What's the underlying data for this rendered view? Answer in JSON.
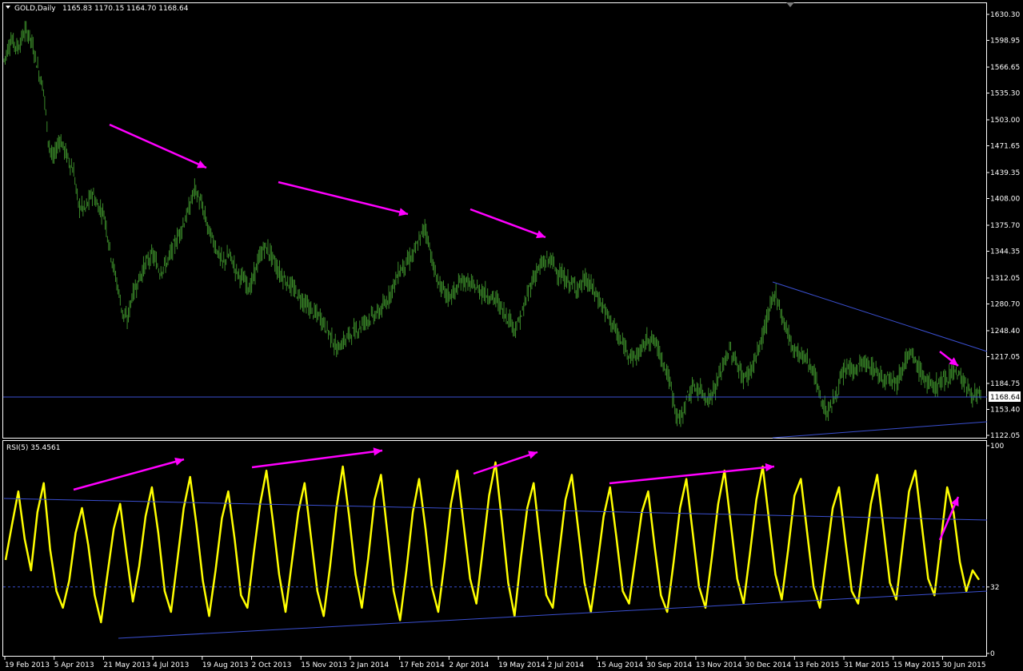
{
  "header": {
    "symbol": "GOLD,Daily",
    "ohlc": "1165.83 1170.15 1164.70 1168.64",
    "rsi_label": "RSI(5) 35.4561"
  },
  "colors": {
    "background": "#000000",
    "border": "#ffffff",
    "candles": "#3b8a2a",
    "rsi": "#ffff00",
    "trendline": "#3a4fcf",
    "arrow": "#ff00ff",
    "price_tag_bg": "#ffffff",
    "price_tag_text": "#000000"
  },
  "price_axis": [
    "1630.30",
    "1598.95",
    "1566.65",
    "1535.30",
    "1503.00",
    "1471.65",
    "1439.35",
    "1408.00",
    "1375.70",
    "1344.35",
    "1312.05",
    "1280.70",
    "1248.40",
    "1217.05",
    "1184.75",
    "1153.40",
    "1122.05"
  ],
  "current_price_tag": "1168.64",
  "rsi_axis": [
    "100",
    "32",
    "0"
  ],
  "date_axis": [
    "19 Feb 2013",
    "5 Apr 2013",
    "21 May 2013",
    "4 Jul 2013",
    "19 Aug 2013",
    "2 Oct 2013",
    "15 Nov 2013",
    "2 Jan 2014",
    "17 Feb 2014",
    "2 Apr 2014",
    "19 May 2014",
    "2 Jul 2014",
    "15 Aug 2014",
    "30 Sep 2014",
    "13 Nov 2014",
    "30 Dec 2014",
    "13 Feb 2015",
    "31 Mar 2015",
    "15 May 2015",
    "30 Jun 2015"
  ],
  "chart_data": [
    {
      "type": "line",
      "title": "GOLD,Daily",
      "x_range": [
        "19 Feb 2013",
        "30 Jun 2015"
      ],
      "ylim": [
        1122.05,
        1630.3
      ],
      "series": [
        {
          "name": "GOLD,Daily",
          "points": [
            [
              0,
              1575
            ],
            [
              6,
              1600
            ],
            [
              12,
              1590
            ],
            [
              18,
              1610
            ],
            [
              22,
              1605
            ],
            [
              26,
              1585
            ],
            [
              30,
              1560
            ],
            [
              34,
              1540
            ],
            [
              38,
              1480
            ],
            [
              42,
              1455
            ],
            [
              48,
              1480
            ],
            [
              54,
              1460
            ],
            [
              60,
              1440
            ],
            [
              64,
              1400
            ],
            [
              70,
              1395
            ],
            [
              76,
              1415
            ],
            [
              80,
              1400
            ],
            [
              86,
              1390
            ],
            [
              92,
              1340
            ],
            [
              98,
              1300
            ],
            [
              102,
              1270
            ],
            [
              106,
              1260
            ],
            [
              110,
              1290
            ],
            [
              116,
              1310
            ],
            [
              122,
              1330
            ],
            [
              128,
              1340
            ],
            [
              134,
              1320
            ],
            [
              140,
              1330
            ],
            [
              146,
              1350
            ],
            [
              152,
              1370
            ],
            [
              158,
              1390
            ],
            [
              164,
              1420
            ],
            [
              170,
              1400
            ],
            [
              176,
              1370
            ],
            [
              182,
              1350
            ],
            [
              188,
              1330
            ],
            [
              194,
              1340
            ],
            [
              200,
              1320
            ],
            [
              206,
              1310
            ],
            [
              212,
              1300
            ],
            [
              218,
              1330
            ],
            [
              224,
              1350
            ],
            [
              230,
              1340
            ],
            [
              236,
              1320
            ],
            [
              242,
              1310
            ],
            [
              248,
              1300
            ],
            [
              254,
              1290
            ],
            [
              260,
              1280
            ],
            [
              266,
              1270
            ],
            [
              272,
              1265
            ],
            [
              278,
              1250
            ],
            [
              282,
              1240
            ],
            [
              286,
              1225
            ],
            [
              292,
              1235
            ],
            [
              298,
              1245
            ],
            [
              304,
              1250
            ],
            [
              310,
              1260
            ],
            [
              316,
              1265
            ],
            [
              322,
              1270
            ],
            [
              328,
              1280
            ],
            [
              334,
              1300
            ],
            [
              340,
              1320
            ],
            [
              346,
              1330
            ],
            [
              352,
              1340
            ],
            [
              358,
              1360
            ],
            [
              362,
              1375
            ],
            [
              366,
              1350
            ],
            [
              370,
              1320
            ],
            [
              376,
              1300
            ],
            [
              382,
              1290
            ],
            [
              388,
              1295
            ],
            [
              394,
              1310
            ],
            [
              400,
              1305
            ],
            [
              406,
              1300
            ],
            [
              412,
              1295
            ],
            [
              418,
              1290
            ],
            [
              424,
              1285
            ],
            [
              430,
              1270
            ],
            [
              436,
              1260
            ],
            [
              440,
              1250
            ],
            [
              446,
              1270
            ],
            [
              452,
              1300
            ],
            [
              458,
              1320
            ],
            [
              464,
              1330
            ],
            [
              470,
              1335
            ],
            [
              476,
              1320
            ],
            [
              482,
              1310
            ],
            [
              488,
              1305
            ],
            [
              494,
              1300
            ],
            [
              500,
              1310
            ],
            [
              506,
              1300
            ],
            [
              512,
              1285
            ],
            [
              518,
              1270
            ],
            [
              524,
              1255
            ],
            [
              530,
              1235
            ],
            [
              536,
              1225
            ],
            [
              542,
              1215
            ],
            [
              548,
              1225
            ],
            [
              554,
              1240
            ],
            [
              560,
              1235
            ],
            [
              566,
              1215
            ],
            [
              572,
              1190
            ],
            [
              578,
              1150
            ],
            [
              582,
              1140
            ],
            [
              588,
              1170
            ],
            [
              594,
              1180
            ],
            [
              600,
              1175
            ],
            [
              606,
              1165
            ],
            [
              612,
              1180
            ],
            [
              618,
              1205
            ],
            [
              624,
              1225
            ],
            [
              630,
              1210
            ],
            [
              636,
              1190
            ],
            [
              642,
              1200
            ],
            [
              648,
              1220
            ],
            [
              654,
              1250
            ],
            [
              660,
              1280
            ],
            [
              664,
              1295
            ],
            [
              668,
              1270
            ],
            [
              672,
              1255
            ],
            [
              678,
              1230
            ],
            [
              684,
              1220
            ],
            [
              690,
              1215
            ],
            [
              696,
              1200
            ],
            [
              700,
              1180
            ],
            [
              704,
              1160
            ],
            [
              708,
              1150
            ],
            [
              714,
              1165
            ],
            [
              720,
              1190
            ],
            [
              726,
              1205
            ],
            [
              732,
              1200
            ],
            [
              738,
              1210
            ],
            [
              744,
              1205
            ],
            [
              750,
              1200
            ],
            [
              756,
              1190
            ],
            [
              762,
              1195
            ],
            [
              768,
              1185
            ],
            [
              774,
              1210
            ],
            [
              780,
              1220
            ],
            [
              786,
              1205
            ],
            [
              792,
              1190
            ],
            [
              798,
              1180
            ],
            [
              804,
              1185
            ],
            [
              810,
              1190
            ],
            [
              816,
              1200
            ],
            [
              822,
              1195
            ],
            [
              828,
              1180
            ],
            [
              834,
              1170
            ],
            [
              840,
              1168.64
            ]
          ]
        }
      ]
    },
    {
      "type": "line",
      "title": "RSI(5) 35.4561",
      "ylim": [
        0,
        100
      ],
      "reference_level": 32,
      "series": [
        {
          "name": "RSI(5)",
          "values": [
            45,
            62,
            78,
            55,
            40,
            68,
            82,
            50,
            30,
            22,
            35,
            58,
            70,
            52,
            28,
            15,
            38,
            60,
            72,
            48,
            25,
            42,
            66,
            80,
            58,
            30,
            20,
            45,
            70,
            85,
            62,
            35,
            18,
            40,
            65,
            78,
            55,
            28,
            22,
            48,
            72,
            88,
            64,
            38,
            20,
            44,
            68,
            82,
            56,
            30,
            18,
            42,
            70,
            90,
            66,
            38,
            22,
            46,
            74,
            86,
            58,
            30,
            16,
            40,
            68,
            84,
            60,
            32,
            20,
            44,
            72,
            88,
            62,
            36,
            24,
            50,
            76,
            92,
            64,
            34,
            18,
            46,
            70,
            82,
            54,
            28,
            22,
            48,
            74,
            86,
            60,
            34,
            20,
            42,
            66,
            80,
            56,
            30,
            24,
            46,
            68,
            78,
            52,
            28,
            20,
            44,
            70,
            84,
            58,
            32,
            22,
            46,
            72,
            88,
            62,
            36,
            24,
            48,
            74,
            90,
            64,
            38,
            26,
            50,
            76,
            84,
            58,
            32,
            22,
            46,
            70,
            80,
            54,
            30,
            24,
            48,
            72,
            86,
            60,
            34,
            26,
            52,
            78,
            88,
            62,
            36,
            28,
            54,
            80,
            68,
            44,
            30,
            40,
            35.46
          ]
        }
      ]
    }
  ]
}
